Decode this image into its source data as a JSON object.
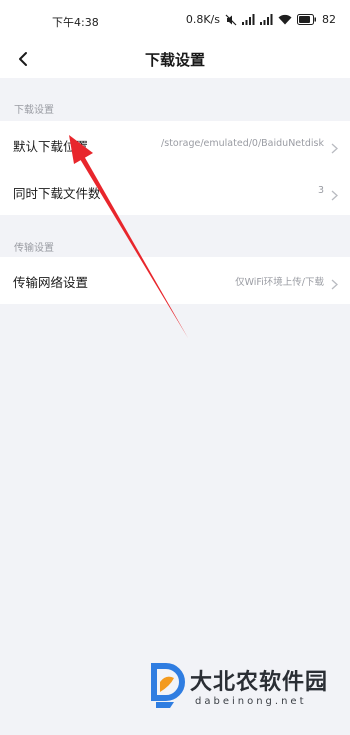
{
  "status_bar": {
    "time": "下午4:38",
    "net_speed": "0.8K/s",
    "battery": "82"
  },
  "header": {
    "title": "下载设置"
  },
  "sections": [
    {
      "title": "下载设置",
      "rows": [
        {
          "label": "默认下载位置",
          "value": "/storage/emulated/0/BaiduNetdisk"
        },
        {
          "label": "同时下载文件数",
          "value": "3"
        }
      ]
    },
    {
      "title": "传输设置",
      "rows": [
        {
          "label": "传输网络设置",
          "value": "仅WiFi环境上传/下载"
        }
      ]
    }
  ],
  "watermark": {
    "title": "大北农软件园",
    "url": "dabeinong.net"
  },
  "colors": {
    "background": "#f2f3f7",
    "arrow": "#e8262c",
    "logo_blue": "#2f7de1",
    "logo_orange": "#f39a1e"
  },
  "icons": [
    "back-arrow-icon",
    "chevron-right-icon",
    "signal-icon",
    "wifi-icon",
    "battery-icon",
    "mute-icon"
  ]
}
